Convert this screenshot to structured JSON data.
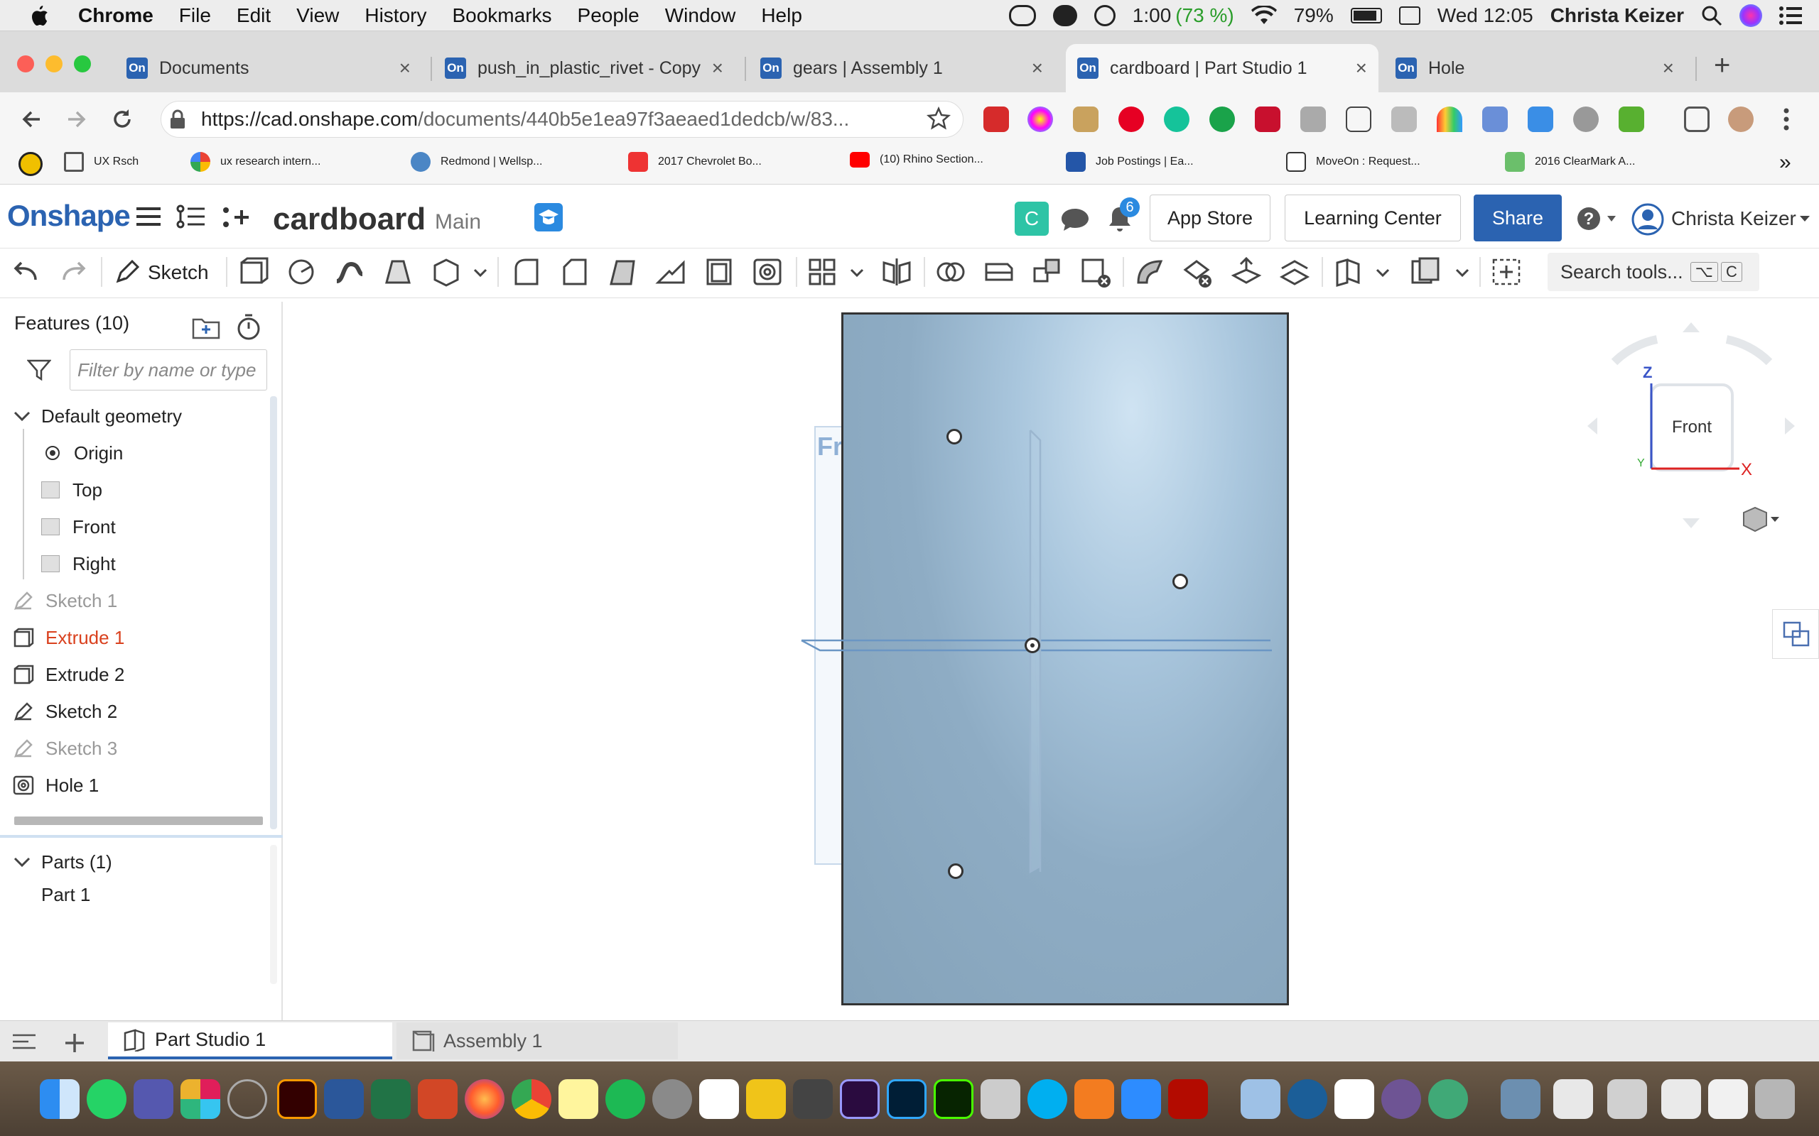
{
  "menubar": {
    "app_name": "Chrome",
    "items": [
      "File",
      "Edit",
      "View",
      "History",
      "Bookmarks",
      "People",
      "Window",
      "Help"
    ],
    "battery_time": "1:00",
    "battery_percent_paren": "(73 %)",
    "wifi_battery": "79%",
    "datetime": "Wed 12:05",
    "user": "Christa Keizer"
  },
  "tabs": [
    {
      "label": "Documents",
      "favicon": "On",
      "close": "×"
    },
    {
      "label": "push_in_plastic_rivet - Copy",
      "favicon": "On",
      "close": "×"
    },
    {
      "label": "gears | Assembly 1",
      "favicon": "On",
      "close": "×"
    },
    {
      "label": "cardboard | Part Studio 1",
      "favicon": "On",
      "close": "×"
    },
    {
      "label": "Hole",
      "favicon": "On",
      "close": "×"
    }
  ],
  "new_tab": "+",
  "address": {
    "url_host": "https://cad.onshape.com",
    "url_path": "/documents/440b5e1ea97f3aeaed1dedcb/w/83..."
  },
  "bookmarks": [
    {
      "label": "UX Rsch",
      "icon": "folder-icon"
    },
    {
      "label": "ux research intern...",
      "icon": "google-icon"
    },
    {
      "label": "Redmond | Wellsp...",
      "icon": "wellspring-icon"
    },
    {
      "label": "2017 Chevrolet Bo...",
      "icon": "cg-icon"
    },
    {
      "label": "(10) Rhino Section...",
      "icon": "youtube-icon"
    },
    {
      "label": "Job Postings | Ea...",
      "icon": "jobs-icon"
    },
    {
      "label": "MoveOn : Request...",
      "icon": "moveon-icon"
    },
    {
      "label": "2016 ClearMark A...",
      "icon": "clearmark-icon"
    }
  ],
  "bookmarks_more": "»",
  "header": {
    "logo": "Onshape",
    "doc_name": "cardboard",
    "branch": "Main",
    "c_badge": "C",
    "notification_count": "6",
    "app_store": "App Store",
    "learning_center": "Learning Center",
    "share": "Share",
    "user": "Christa Keizer"
  },
  "toolbar": {
    "sketch_label": "Sketch",
    "search_placeholder": "Search tools...",
    "shortcut_1": "⌥",
    "shortcut_2": "C"
  },
  "features": {
    "title": "Features (10)",
    "filter_placeholder": "Filter by name or type",
    "default_geometry": "Default geometry",
    "geometry_items": [
      "Origin",
      "Top",
      "Front",
      "Right"
    ],
    "items": [
      {
        "label": "Sketch 1",
        "state": "suppressed"
      },
      {
        "label": "Extrude 1",
        "state": "error"
      },
      {
        "label": "Extrude 2",
        "state": "normal"
      },
      {
        "label": "Sketch 2",
        "state": "normal"
      },
      {
        "label": "Sketch 3",
        "state": "suppressed"
      },
      {
        "label": "Hole 1",
        "state": "normal"
      }
    ],
    "parts_title": "Parts (1)",
    "parts": [
      "Part 1"
    ]
  },
  "viewport": {
    "plane_label": "Fr",
    "view_cube_face": "Front",
    "axis_z": "Z",
    "axis_x": "X",
    "axis_y": "Y"
  },
  "bottom_tabs": [
    {
      "label": "Part Studio 1",
      "active": true
    },
    {
      "label": "Assembly 1",
      "active": false
    }
  ],
  "colors": {
    "onshape_blue": "#2b63b1",
    "error_red": "#d9411e",
    "part_face": "#8fb0c8"
  }
}
